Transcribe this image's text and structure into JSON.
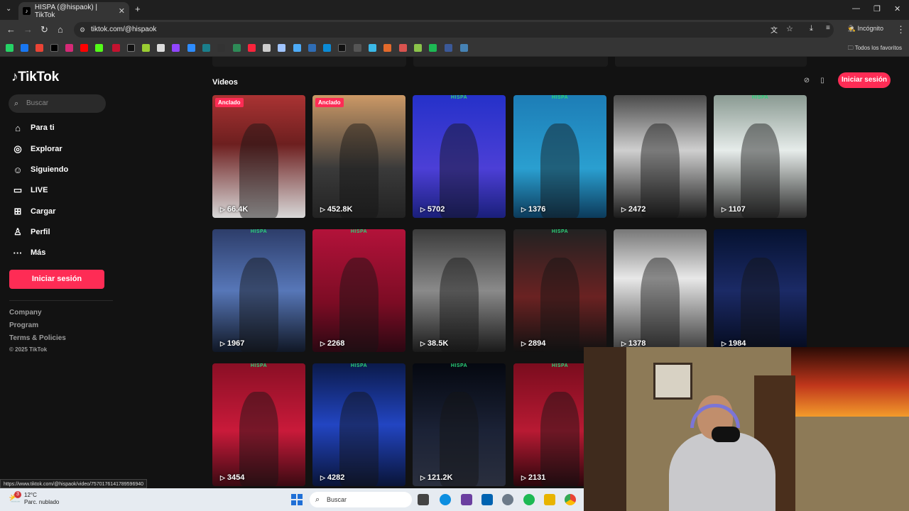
{
  "browser": {
    "tab_title": "HISPA (@hispaok) | TikTok",
    "url": "tiktok.com/@hispaok",
    "incognito_label": "Incógnito",
    "all_bookmarks": "Todos los favoritos",
    "new_tab": "+",
    "tab_close": "✕"
  },
  "sidebar": {
    "logo": "TikTok",
    "search_placeholder": "Buscar",
    "nav": [
      {
        "label": "Para ti",
        "icon": "home-icon"
      },
      {
        "label": "Explorar",
        "icon": "compass-icon"
      },
      {
        "label": "Siguiendo",
        "icon": "following-icon"
      },
      {
        "label": "LIVE",
        "icon": "live-icon"
      },
      {
        "label": "Cargar",
        "icon": "upload-icon"
      },
      {
        "label": "Perfil",
        "icon": "profile-icon"
      },
      {
        "label": "Más",
        "icon": "more-icon"
      }
    ],
    "login_button": "Iniciar sesión",
    "footer": [
      "Company",
      "Program",
      "Terms & Policies"
    ],
    "copyright": "© 2025 TikTok"
  },
  "main": {
    "section_title": "Videos",
    "login_button": "Iniciar sesión",
    "pinned_label": "Anclado",
    "brand_tag": "HISPA",
    "videos": [
      {
        "views": "66.4K",
        "pinned": true
      },
      {
        "views": "452.8K",
        "pinned": true
      },
      {
        "views": "5702"
      },
      {
        "views": "1376"
      },
      {
        "views": "2472"
      },
      {
        "views": "1107"
      },
      {
        "views": "1967"
      },
      {
        "views": "2268"
      },
      {
        "views": "38.5K"
      },
      {
        "views": "2894"
      },
      {
        "views": "1378"
      },
      {
        "views": "1984"
      },
      {
        "views": "3454"
      },
      {
        "views": "4282"
      },
      {
        "views": "121.2K"
      },
      {
        "views": "2131"
      }
    ]
  },
  "status_url": "https://www.tiktok.com/@hispaok/video/7570176141789596940",
  "taskbar": {
    "temperature": "12°C",
    "weather": "Parc. nublado",
    "search": "Buscar",
    "notification_count": "3"
  },
  "colors": {
    "accent": "#fe2c55",
    "page_bg": "#121212",
    "brand_green": "#2bd47a"
  }
}
